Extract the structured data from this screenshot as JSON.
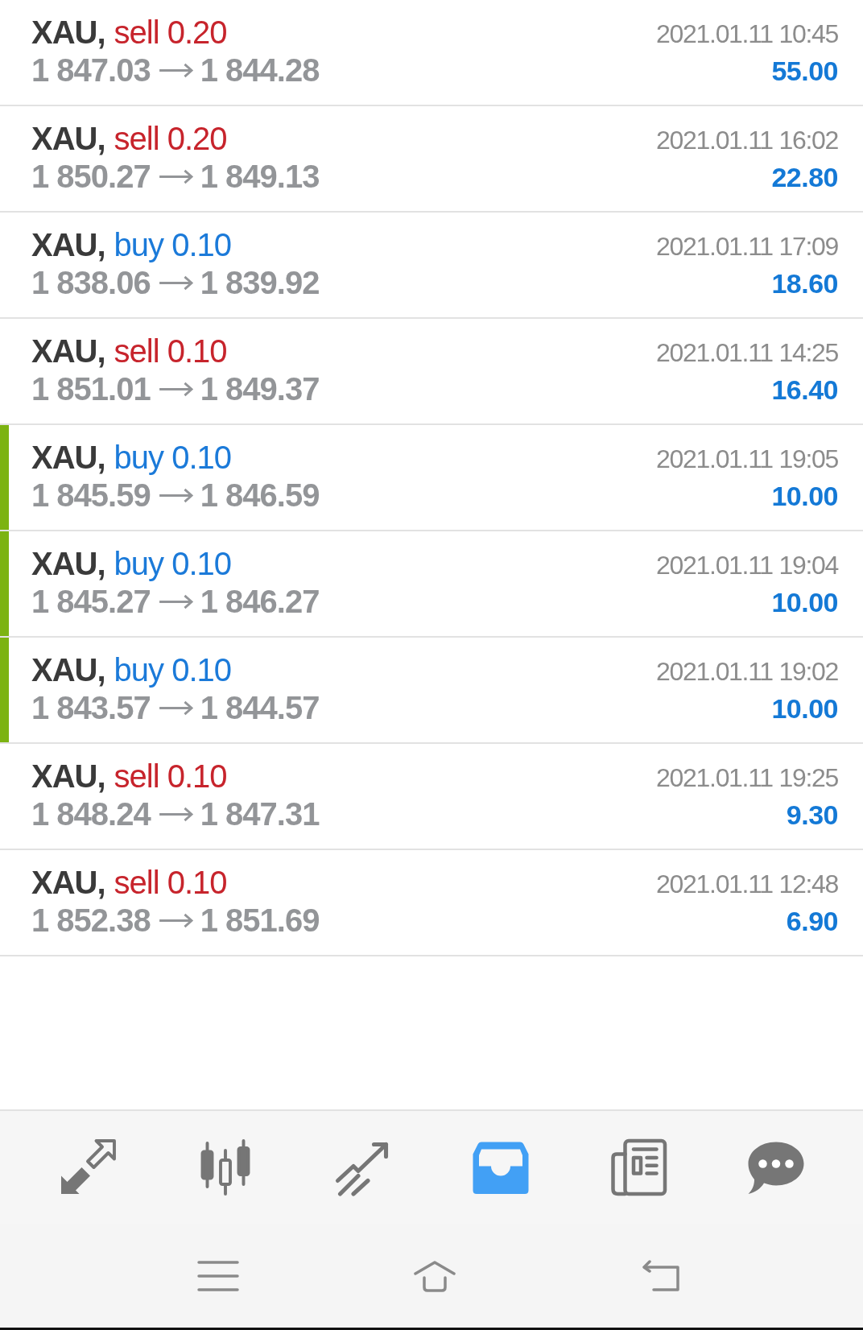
{
  "trades": [
    {
      "symbol": "XAU,",
      "order": "sell 0.20",
      "kind": "sell",
      "open_price": "1 847.03",
      "close_price": "1 844.28",
      "time": "2021.01.11 10:45",
      "profit": "55.00",
      "highlighted": false
    },
    {
      "symbol": "XAU,",
      "order": "sell 0.20",
      "kind": "sell",
      "open_price": "1 850.27",
      "close_price": "1 849.13",
      "time": "2021.01.11 16:02",
      "profit": "22.80",
      "highlighted": false
    },
    {
      "symbol": "XAU,",
      "order": "buy 0.10",
      "kind": "buy",
      "open_price": "1 838.06",
      "close_price": "1 839.92",
      "time": "2021.01.11 17:09",
      "profit": "18.60",
      "highlighted": false
    },
    {
      "symbol": "XAU,",
      "order": "sell 0.10",
      "kind": "sell",
      "open_price": "1 851.01",
      "close_price": "1 849.37",
      "time": "2021.01.11 14:25",
      "profit": "16.40",
      "highlighted": false
    },
    {
      "symbol": "XAU,",
      "order": "buy 0.10",
      "kind": "buy",
      "open_price": "1 845.59",
      "close_price": "1 846.59",
      "time": "2021.01.11 19:05",
      "profit": "10.00",
      "highlighted": true
    },
    {
      "symbol": "XAU,",
      "order": "buy 0.10",
      "kind": "buy",
      "open_price": "1 845.27",
      "close_price": "1 846.27",
      "time": "2021.01.11 19:04",
      "profit": "10.00",
      "highlighted": true
    },
    {
      "symbol": "XAU,",
      "order": "buy 0.10",
      "kind": "buy",
      "open_price": "1 843.57",
      "close_price": "1 844.57",
      "time": "2021.01.11 19:02",
      "profit": "10.00",
      "highlighted": true
    },
    {
      "symbol": "XAU,",
      "order": "sell 0.10",
      "kind": "sell",
      "open_price": "1 848.24",
      "close_price": "1 847.31",
      "time": "2021.01.11 19:25",
      "profit": "9.30",
      "highlighted": false
    },
    {
      "symbol": "XAU,",
      "order": "sell 0.10",
      "kind": "sell",
      "open_price": "1 852.38",
      "close_price": "1 851.69",
      "time": "2021.01.11 12:48",
      "profit": "6.90",
      "highlighted": false
    }
  ],
  "tab_bar": {
    "tabs": [
      {
        "selected": false
      },
      {
        "selected": false
      },
      {
        "selected": false
      },
      {
        "selected": true
      },
      {
        "selected": false
      },
      {
        "selected": false
      }
    ]
  }
}
